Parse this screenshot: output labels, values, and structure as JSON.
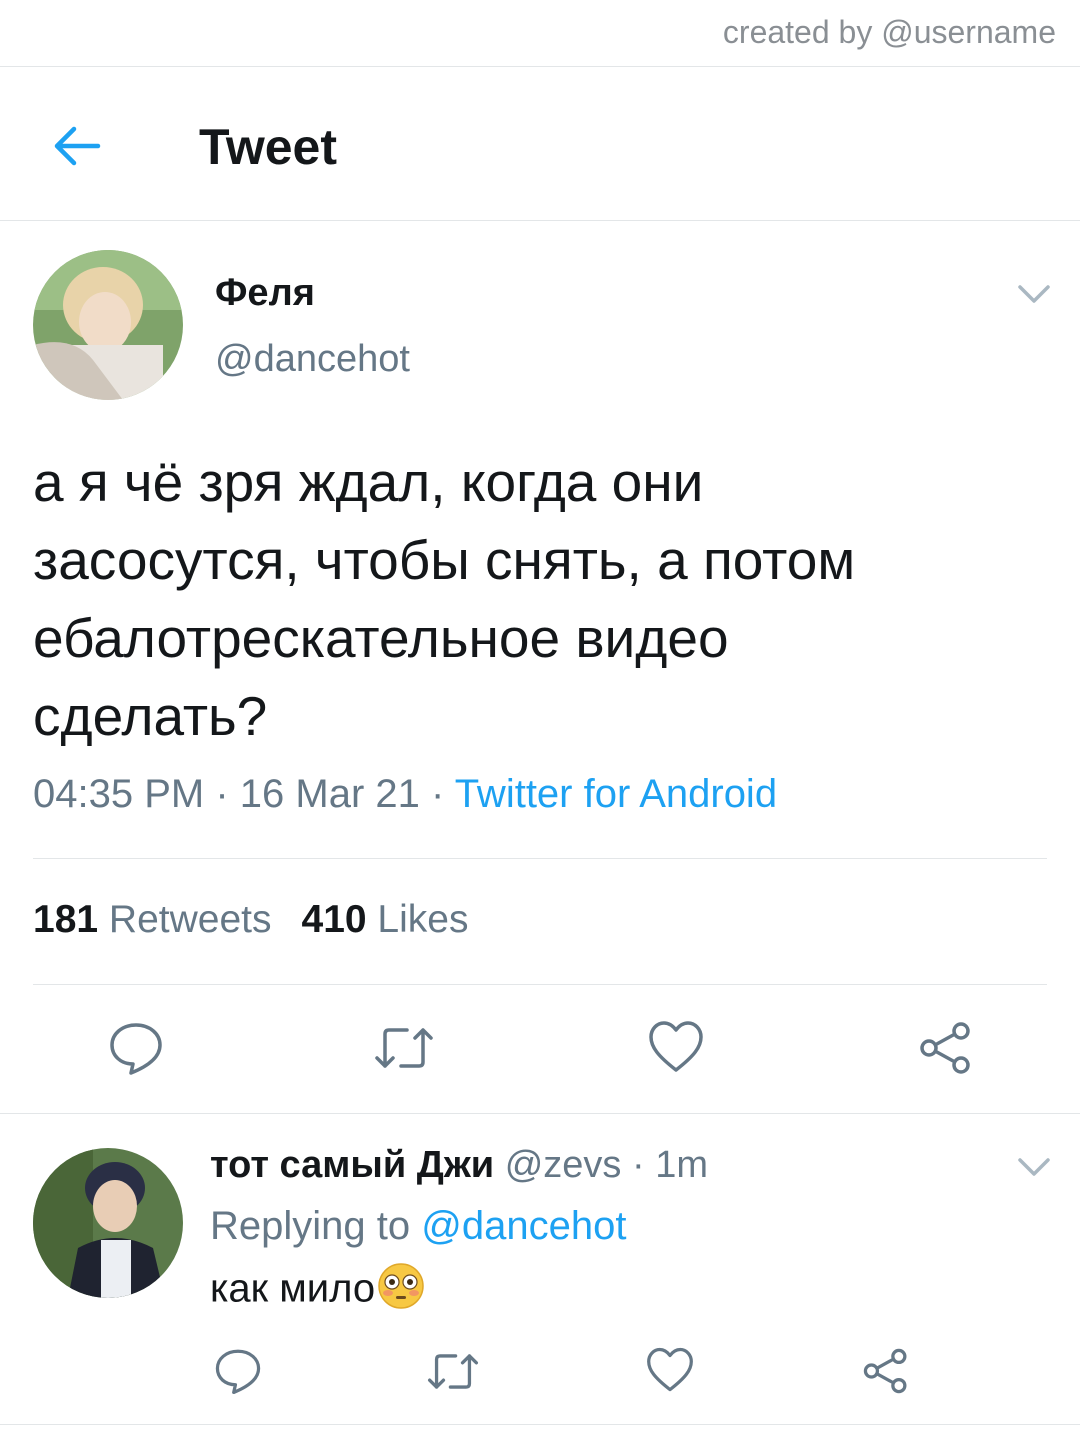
{
  "watermark": "created by @username",
  "header": {
    "title": "Tweet",
    "back_icon": "arrow-left-icon"
  },
  "tweet": {
    "author_name": "Феля",
    "author_handle": "@dancehot",
    "text_lines": [
      "а я чё зря ждал, когда они",
      "засосутся, чтобы снять, а потом",
      "ебалотрескательное видео",
      "сделать?"
    ],
    "time": "04:35 PM",
    "date": "16 Mar 21",
    "separator": " · ",
    "source": "Twitter for Android",
    "retweets_count": "181",
    "retweets_label": "Retweets",
    "likes_count": "410",
    "likes_label": "Likes"
  },
  "reply": {
    "author_name": "тот самый Джи",
    "author_handle": "@zevs",
    "separator": " · ",
    "time": "1m",
    "replying_to_label": "Replying to ",
    "replying_to_handle": "@dancehot",
    "text": "как мило"
  },
  "icons": [
    "reply-icon",
    "retweet-icon",
    "like-icon",
    "share-icon",
    "chevron-down-icon",
    "flushed-face-emoji"
  ],
  "colors": {
    "accent": "#1da1f2",
    "text": "#14171a",
    "secondary": "#657786",
    "divider": "#e3e6e8"
  }
}
